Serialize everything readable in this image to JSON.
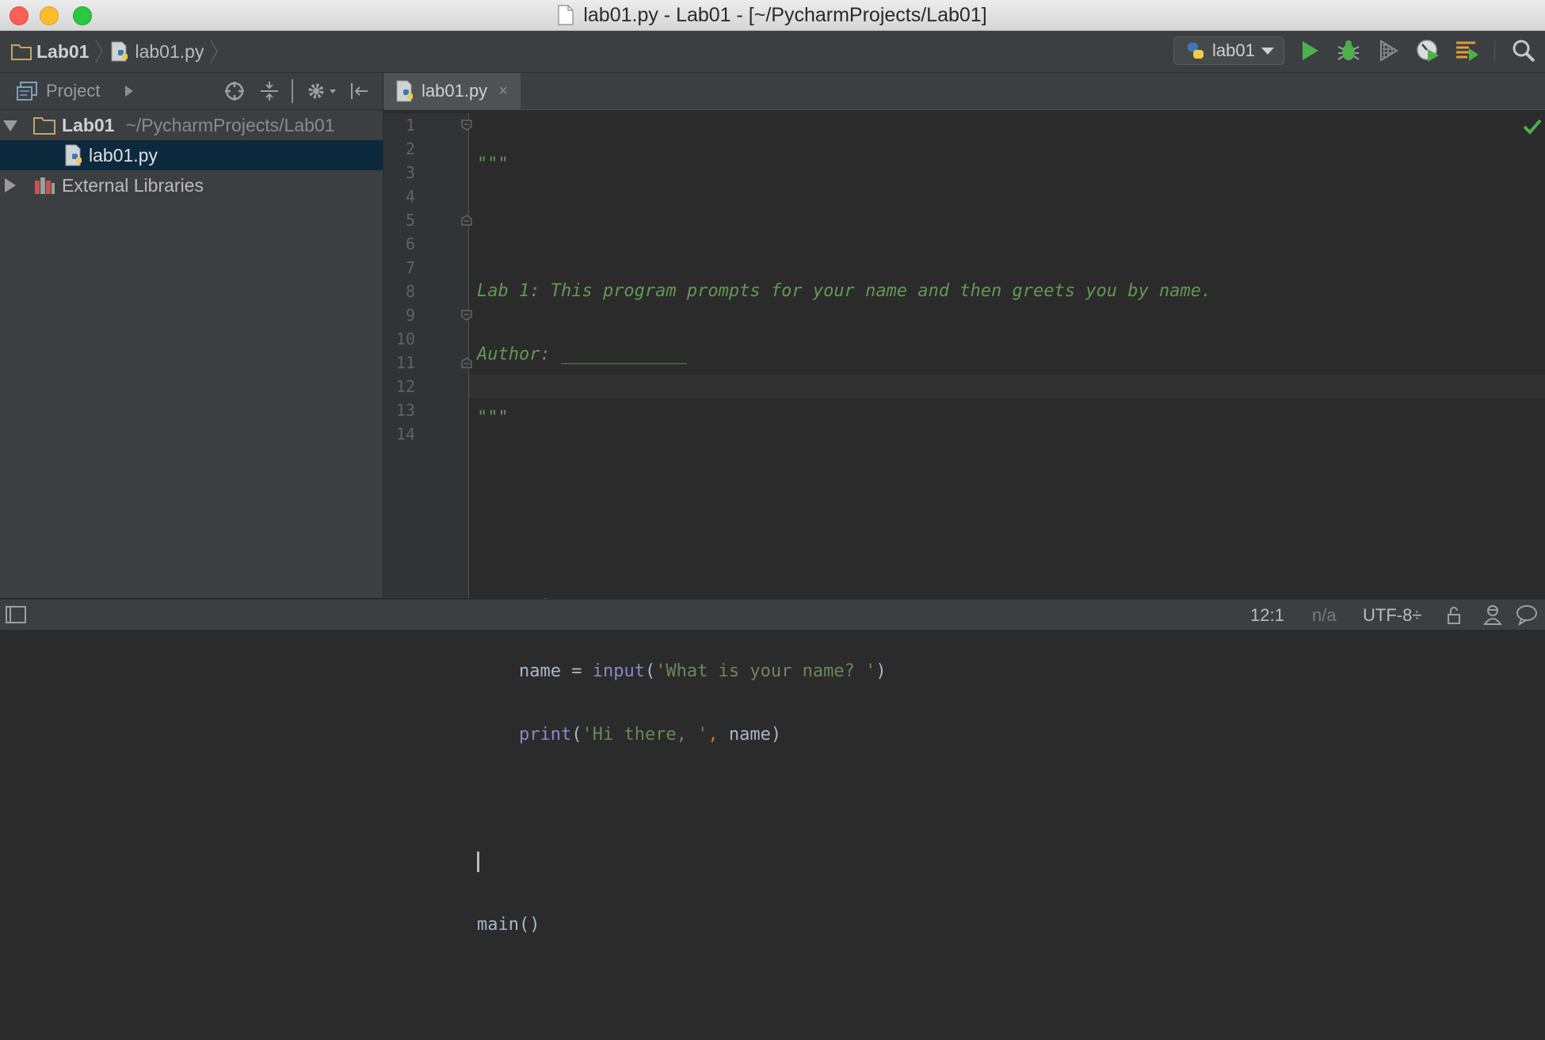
{
  "window": {
    "title": "lab01.py - Lab01 - [~/PycharmProjects/Lab01]"
  },
  "navbar": {
    "crumbs": [
      "Lab01",
      "lab01.py"
    ],
    "run_config": "lab01"
  },
  "project_panel": {
    "title": "Project",
    "tree": [
      {
        "name": "Lab01",
        "path": "~/PycharmProjects/Lab01",
        "expanded": true
      },
      {
        "name": "lab01.py",
        "selected": true
      },
      {
        "name": "External Libraries",
        "expanded": false
      }
    ]
  },
  "editor": {
    "tab": "lab01.py",
    "tab_close": "×",
    "line_numbers": [
      "1",
      "2",
      "3",
      "4",
      "5",
      "6",
      "7",
      "8",
      "9",
      "10",
      "11",
      "12",
      "13",
      "14"
    ],
    "current_line": 12
  },
  "status": {
    "position": "12:1",
    "na": "n/a",
    "encoding": "UTF-8÷"
  },
  "colors": {
    "docstring": "#629755",
    "keyword": "#cc7832",
    "string": "#6a8759",
    "builtin": "#8888c6"
  }
}
